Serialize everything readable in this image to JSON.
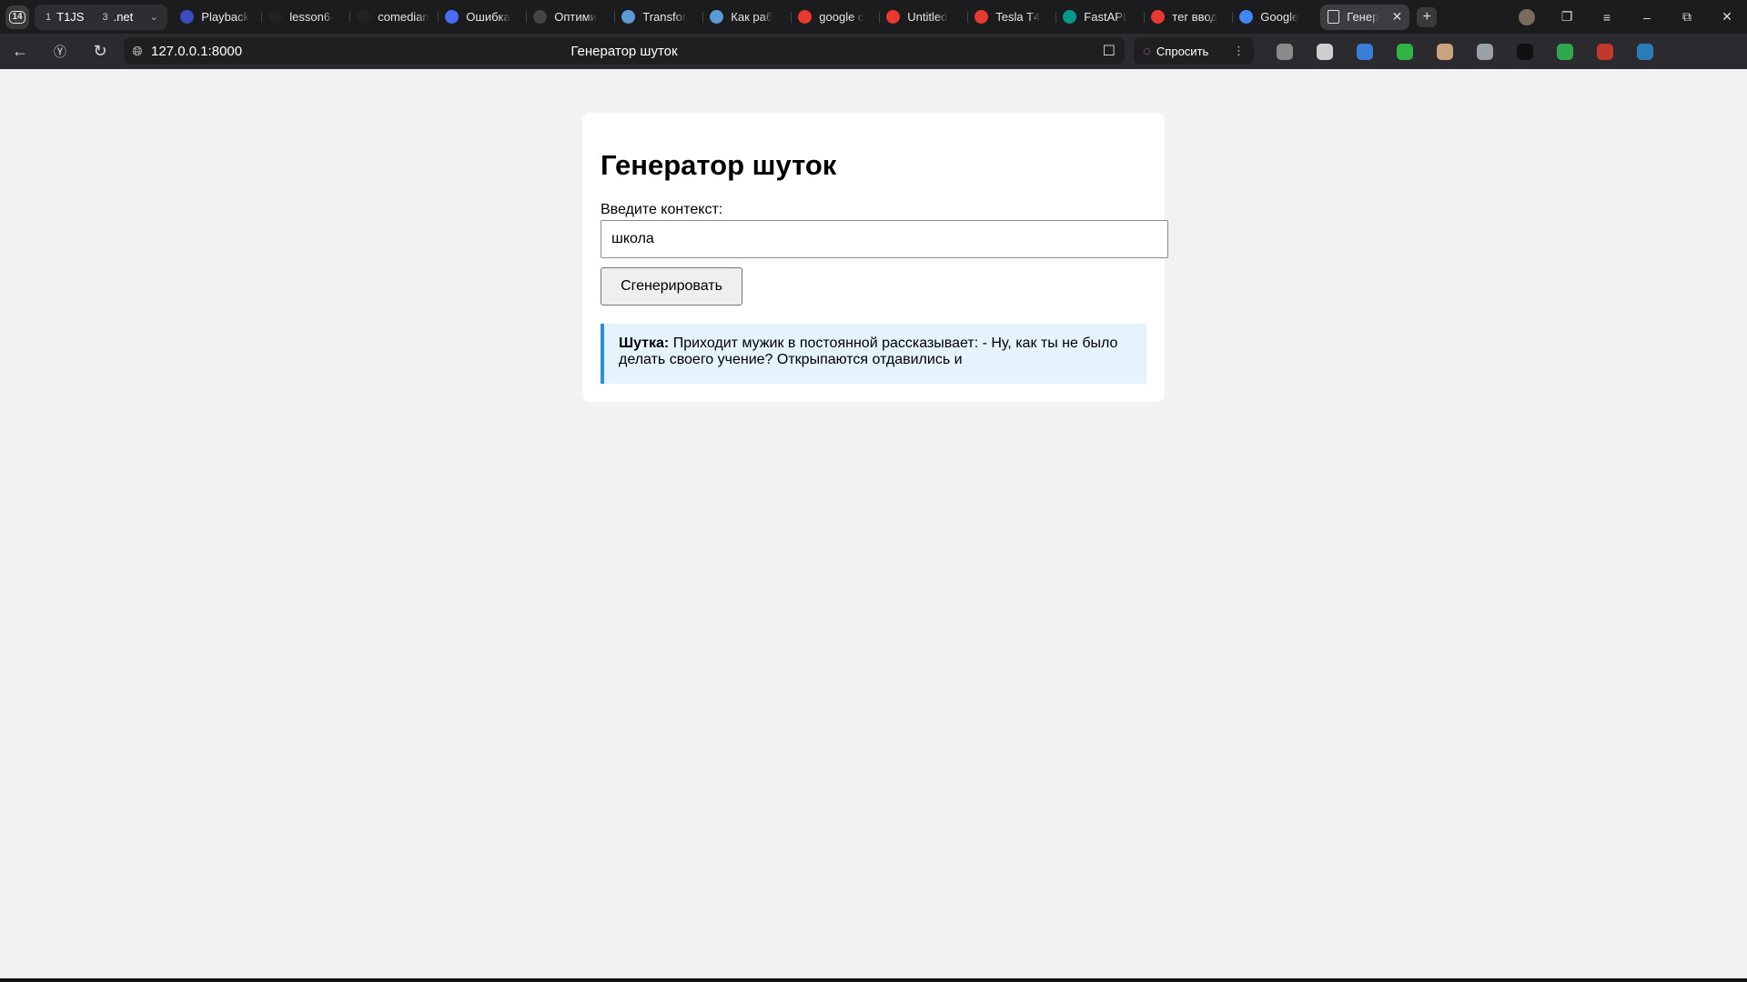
{
  "browser": {
    "tab_count": "14",
    "group": {
      "items": [
        {
          "num": "1",
          "label": "T1JS"
        },
        {
          "num": "3",
          "label": ".net"
        }
      ]
    },
    "tabs": [
      {
        "title": "Playback",
        "icon": "b-icon",
        "color": "#3b4cc0"
      },
      {
        "title": "lesson6-",
        "icon": "github-icon",
        "color": "#222222"
      },
      {
        "title": "comedian",
        "icon": "github-icon",
        "color": "#222222"
      },
      {
        "title": "Ошибка",
        "icon": "bird-icon",
        "color": "#4a6cf7"
      },
      {
        "title": "Оптими",
        "icon": "openai-icon",
        "color": "#444444"
      },
      {
        "title": "Transfor",
        "icon": "puzzle-icon",
        "color": "#5b9bd5"
      },
      {
        "title": "Как раб",
        "icon": "puzzle-icon",
        "color": "#5b9bd5"
      },
      {
        "title": "google с",
        "icon": "yandex-icon",
        "color": "#e8392f"
      },
      {
        "title": "Untitled",
        "icon": "colab-icon",
        "color": "#e8392f"
      },
      {
        "title": "Tesla T4",
        "icon": "yandex-icon",
        "color": "#e8392f"
      },
      {
        "title": "FastAPI",
        "icon": "fastapi-icon",
        "color": "#05998b"
      },
      {
        "title": "тег ввод",
        "icon": "yandex-icon",
        "color": "#e8392f"
      },
      {
        "title": "Google",
        "icon": "translate-icon",
        "color": "#4285f4"
      }
    ],
    "active_tab": {
      "title": "Генер",
      "icon": "page-icon"
    },
    "url": "127.0.0.1:8000",
    "page_title": "Генератор шуток",
    "ask_label": "Спросить",
    "extension_colors": [
      "#8a8a8a",
      "#cfcfcf",
      "#3b7dd8",
      "#2fb344",
      "#c9a27e",
      "#9aa0a6",
      "#111111",
      "#2fa84f",
      "#c0392b",
      "#2b7bb9"
    ]
  },
  "page": {
    "title": "Генератор шуток",
    "context_label": "Введите контекст:",
    "context_value": "школа",
    "generate_button": "Сгенерировать",
    "result_label": "Шутка:",
    "result_text": "Приходит мужик в постоянной рассказывает: - Ну, как ты не было делать своего учение? Открыпаются отдавились и"
  }
}
